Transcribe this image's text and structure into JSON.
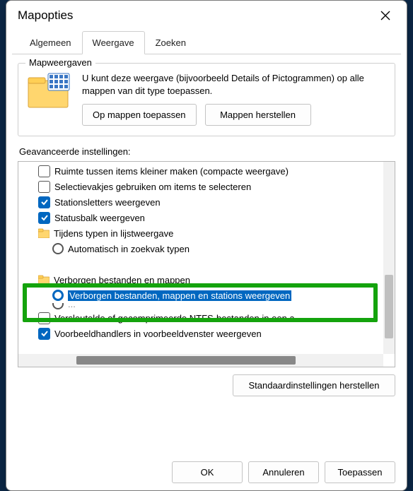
{
  "window": {
    "title": "Mapopties"
  },
  "tabs": {
    "general": "Algemeen",
    "view": "Weergave",
    "search": "Zoeken"
  },
  "mapviews": {
    "legend": "Mapweergaven",
    "text": "U kunt deze weergave (bijvoorbeeld Details of Pictogrammen) op alle mappen van dit type toepassen.",
    "apply_btn": "Op mappen toepassen",
    "reset_btn": "Mappen herstellen"
  },
  "advanced": {
    "label": "Geavanceerde instellingen:",
    "items": [
      {
        "kind": "cb",
        "indent": 1,
        "checked": false,
        "label": "Ruimte tussen items kleiner maken (compacte weergave)"
      },
      {
        "kind": "cb",
        "indent": 1,
        "checked": false,
        "label": "Selectievakjes gebruiken om items te selecteren"
      },
      {
        "kind": "cb",
        "indent": 1,
        "checked": true,
        "label": "Stationsletters weergeven"
      },
      {
        "kind": "cb",
        "indent": 1,
        "checked": true,
        "label": "Statusbalk weergeven"
      },
      {
        "kind": "folder",
        "indent": 1,
        "label": "Tijdens typen in lijstweergave"
      },
      {
        "kind": "radio",
        "indent": 2,
        "checked": false,
        "label": "Automatisch in zoekvak typen"
      },
      {
        "kind": "gap"
      },
      {
        "kind": "folder",
        "indent": 1,
        "label": "Verborgen bestanden en mappen"
      },
      {
        "kind": "radio",
        "indent": 2,
        "checked": true,
        "selected": true,
        "label": "Verborgen bestanden, mappen en stations weergeven"
      },
      {
        "kind": "cb",
        "indent": 1,
        "checked": false,
        "partial_above": true,
        "label": "Versleutelde of gecomprimeerde NTFS-bestanden in een a"
      },
      {
        "kind": "cb",
        "indent": 1,
        "checked": true,
        "label": "Voorbeeldhandlers in voorbeeldvenster weergeven"
      }
    ],
    "restore_btn": "Standaardinstellingen herstellen"
  },
  "footer": {
    "ok": "OK",
    "cancel": "Annuleren",
    "apply": "Toepassen"
  }
}
